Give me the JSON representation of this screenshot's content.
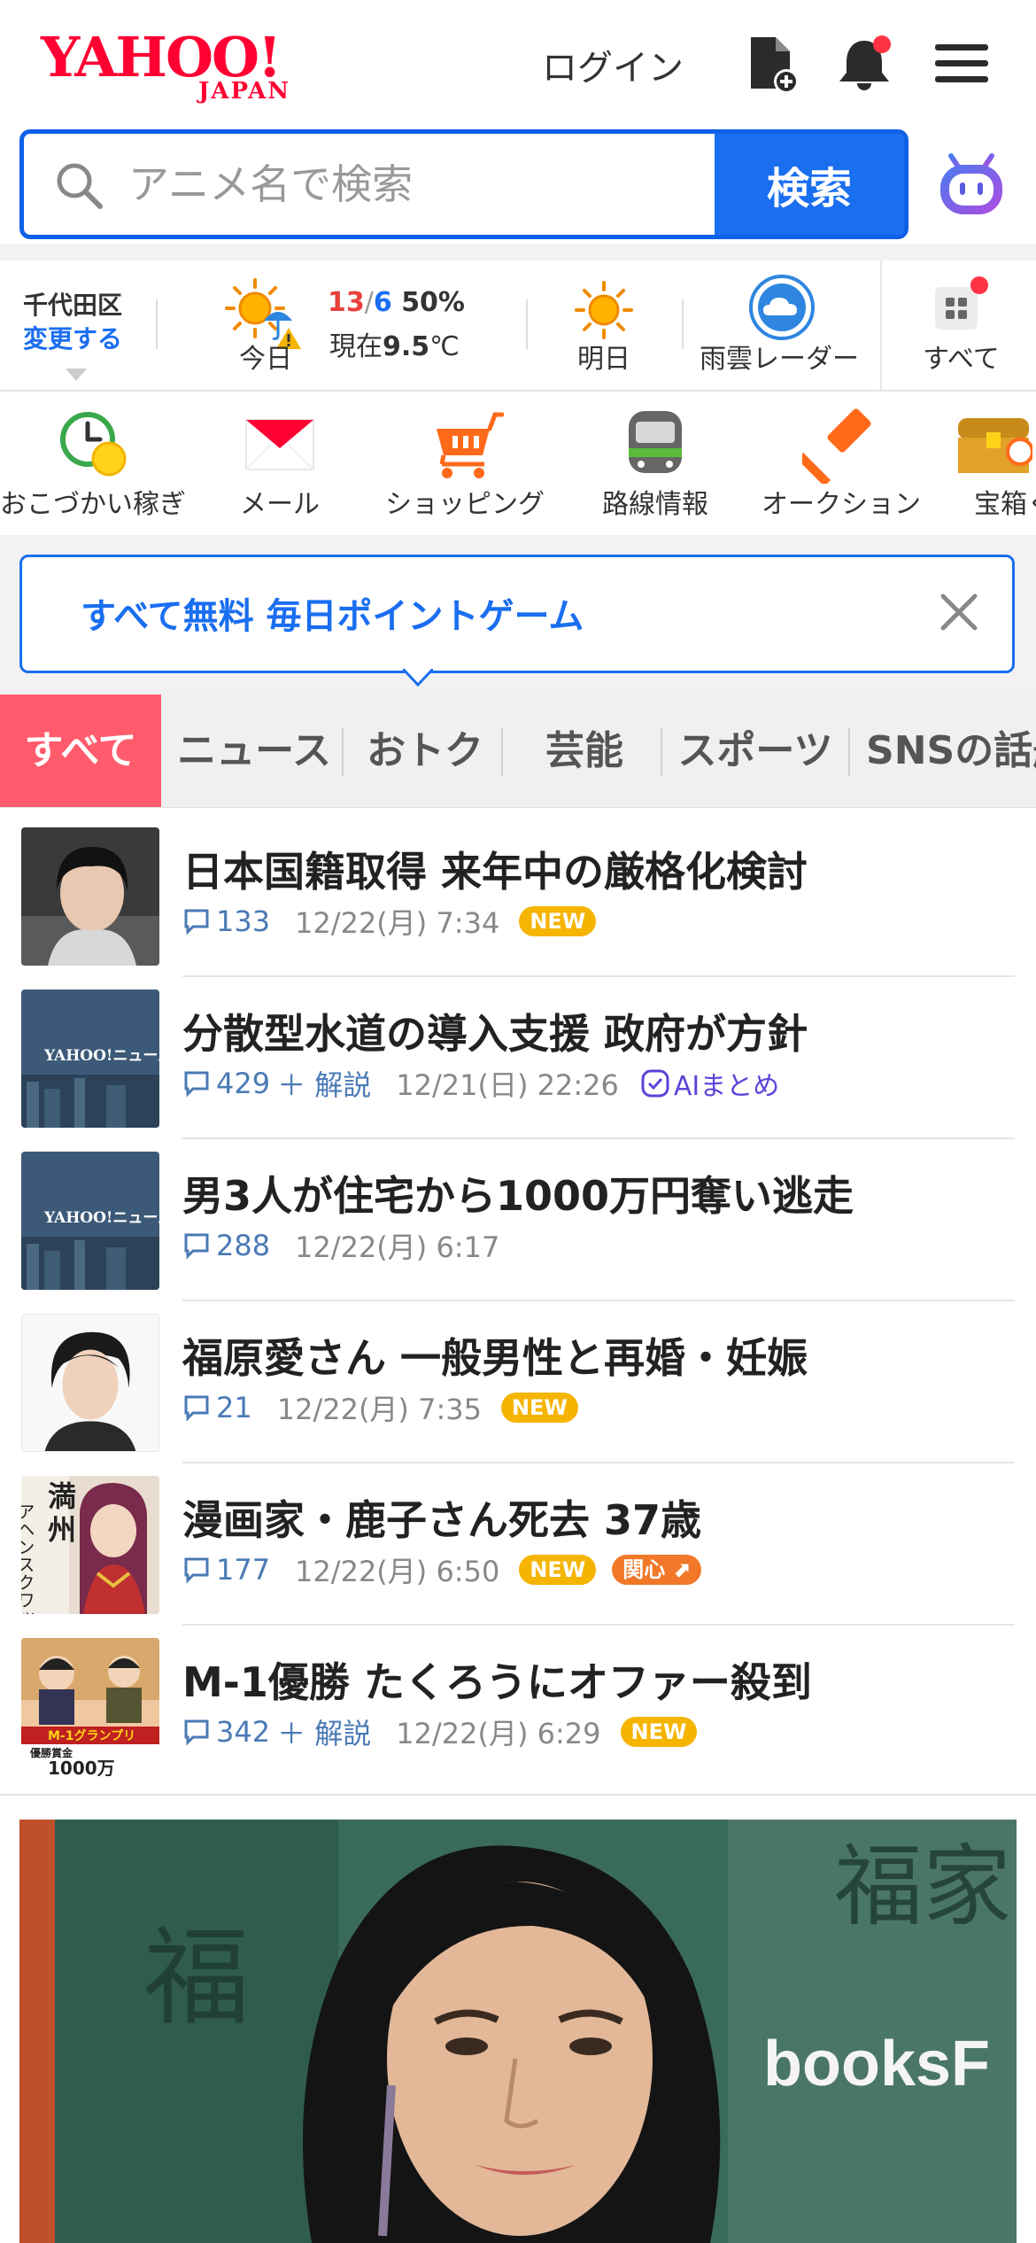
{
  "header": {
    "logo_main": "YAHOO!",
    "logo_sub": "JAPAN",
    "login_label": "ログイン"
  },
  "search": {
    "placeholder": "アニメ名で検索",
    "button_label": "検索"
  },
  "weather": {
    "location": "千代田区",
    "change_label": "変更する",
    "today_label": "今日",
    "high": "13",
    "separator": "/",
    "low": "6",
    "precip": "50%",
    "now_prefix": "現在",
    "now_temp": "9.5",
    "now_unit": "℃",
    "tomorrow_label": "明日",
    "radar_label": "雨雲レーダー",
    "all_label": "すべて"
  },
  "services": [
    {
      "label": "おこづかい稼ぎ",
      "icon": "clock-coin-icon"
    },
    {
      "label": "メール",
      "icon": "mail-icon"
    },
    {
      "label": "ショッピング",
      "icon": "cart-icon"
    },
    {
      "label": "路線情報",
      "icon": "train-icon"
    },
    {
      "label": "オークション",
      "icon": "auction-hammer-icon"
    },
    {
      "label": "宝箱くじ",
      "icon": "treasure-box-icon"
    }
  ],
  "promo": {
    "text": "すべて無料 毎日ポイントゲーム"
  },
  "tabs": [
    {
      "label": "すべて"
    },
    {
      "label": "ニュース"
    },
    {
      "label": "おトク"
    },
    {
      "label": "芸能"
    },
    {
      "label": "スポーツ"
    },
    {
      "label": "SNSの話題"
    }
  ],
  "news": [
    {
      "title": "日本国籍取得 来年中の厳格化検討",
      "comments": "133",
      "kaisetsu": "",
      "time": "12/22(月) 7:34",
      "badge": "NEW",
      "ai": ""
    },
    {
      "title": "分散型水道の導入支援 政府が方針",
      "comments": "429",
      "kaisetsu": "＋ 解説",
      "time": "12/21(日) 22:26",
      "badge": "",
      "ai": "AIまとめ"
    },
    {
      "title": "男3人が住宅から1000万円奪い逃走",
      "comments": "288",
      "kaisetsu": "",
      "time": "12/22(月) 6:17",
      "badge": "",
      "ai": ""
    },
    {
      "title": "福原愛さん 一般男性と再婚・妊娠",
      "comments": "21",
      "kaisetsu": "",
      "time": "12/22(月) 7:35",
      "badge": "NEW",
      "ai": ""
    },
    {
      "title": "漫画家・鹿子さん死去 37歳",
      "comments": "177",
      "kaisetsu": "",
      "time": "12/22(月) 6:50",
      "badge": "NEW",
      "interest": "関心",
      "ai": ""
    },
    {
      "title": "M-1優勝 たくろうにオファー殺到",
      "comments": "342",
      "kaisetsu": "＋ 解説",
      "time": "12/22(月) 6:29",
      "badge": "NEW",
      "ai": ""
    }
  ],
  "thumb_text": {
    "yahoo_news": "YAHOO!ニュース",
    "manga_col1": "満州",
    "manga_col2": "アヘンスクワッド",
    "m1_banner": "M-1グランプリ",
    "m1_prize": "優勝賞金",
    "m1_amount": "1000万"
  },
  "photo_text": {
    "sign_kanji": "福",
    "sign_kanji_right": "福家",
    "sign_books": "booksF"
  },
  "colors": {
    "brand_red": "#ff0033",
    "accent_blue": "#1a6ef0",
    "tab_active": "#ff5b6c",
    "badge_new": "#f5b400",
    "badge_interest": "#f07828"
  }
}
